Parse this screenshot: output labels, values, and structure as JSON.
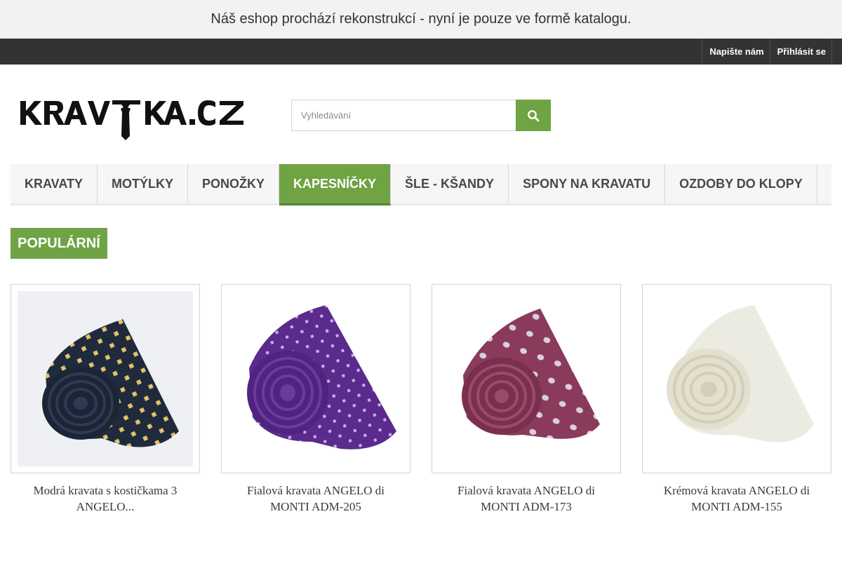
{
  "notice": {
    "text": "Náš eshop prochází rekonstrukcí - nyní je pouze ve formě katalogu."
  },
  "top_nav": {
    "links": [
      {
        "label": "Napište nám"
      },
      {
        "label": "Přihlásit se"
      }
    ]
  },
  "header": {
    "logo_text": "KRAVATKA.CZ",
    "search": {
      "placeholder": "Vyhledávání",
      "button_icon": "search-icon"
    }
  },
  "menu": {
    "items": [
      {
        "label": "KRAVATY",
        "active": false
      },
      {
        "label": "MOTÝLKY",
        "active": false
      },
      {
        "label": "PONOŽKY",
        "active": false
      },
      {
        "label": "KAPESNÍČKY",
        "active": true
      },
      {
        "label": "ŠLE - KŠANDY",
        "active": false
      },
      {
        "label": "SPONY NA KRAVATU",
        "active": false
      },
      {
        "label": "OZDOBY DO KLOPY",
        "active": false
      }
    ]
  },
  "section": {
    "title": "POPULÁRNÍ"
  },
  "products": [
    {
      "name": "Modrá kravata s kostičkama 3 ANGELO..."
    },
    {
      "name": "Fialová kravata ANGELO di MONTI ADM-205"
    },
    {
      "name": "Fialová kravata ANGELO di MONTI ADM-173"
    },
    {
      "name": "Krémová kravata ANGELO di MONTI ADM-155"
    }
  ],
  "colors": {
    "accent": "#6fa344",
    "top_nav_bg": "#333333",
    "notice_bg": "#f2f2f2"
  }
}
